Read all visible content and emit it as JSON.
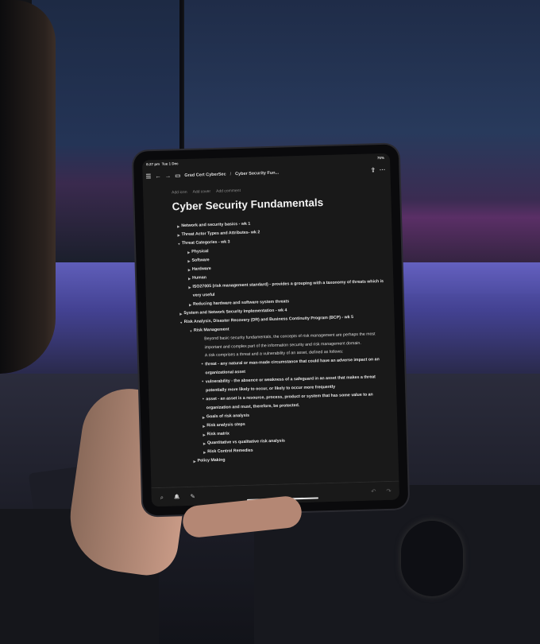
{
  "status": {
    "time": "8:27 pm",
    "date": "Tue 1 Dec",
    "battery": "76%"
  },
  "toolbar": {
    "breadcrumb_parent": "Grad Cert CyberSec",
    "separator": "/",
    "breadcrumb_current": "Cyber Security Fun..."
  },
  "page_meta": {
    "add_icon": "Add icon",
    "add_cover": "Add cover",
    "add_comment": "Add comment"
  },
  "page": {
    "title": "Cyber Security Fundamentals"
  },
  "items": [
    {
      "level": 0,
      "type": "toggle",
      "open": false,
      "text": "Network and security basics - wk 1"
    },
    {
      "level": 0,
      "type": "toggle",
      "open": false,
      "text": "Threat Actor Types and Attributes- wk 2"
    },
    {
      "level": 0,
      "type": "toggle",
      "open": true,
      "text": "Threat Categories - wk 3"
    },
    {
      "level": 1,
      "type": "toggle",
      "open": false,
      "text": "Physical"
    },
    {
      "level": 1,
      "type": "toggle",
      "open": false,
      "text": "Software"
    },
    {
      "level": 1,
      "type": "toggle",
      "open": false,
      "text": "Hardware"
    },
    {
      "level": 1,
      "type": "toggle",
      "open": false,
      "text": "Human"
    },
    {
      "level": 1,
      "type": "toggle",
      "open": false,
      "text": "ISO27005 (risk management standard) - provides a grouping with a taxonomy of threats which is very useful"
    },
    {
      "level": 1,
      "type": "toggle",
      "open": false,
      "text": "Reducing hardware and software system threats"
    },
    {
      "level": 0,
      "type": "toggle",
      "open": false,
      "text": "System and Network Security Implementation - wk 4"
    },
    {
      "level": 0,
      "type": "toggle",
      "open": true,
      "text": "Risk Analysis, Disaster Recovery (DR) and Business Continuity Program (BCP) - wk 5"
    },
    {
      "level": 1,
      "type": "toggle",
      "open": true,
      "text": "Risk Management"
    },
    {
      "level": 2,
      "type": "para",
      "text": "Beyond basic security fundamentals, the concepts of risk management are perhaps the most important and complex part of the information security and risk management domain."
    },
    {
      "level": 2,
      "type": "para",
      "text": "A risk comprises a threat and a vulnerability of an asset, defined as follows:"
    },
    {
      "level": 2,
      "type": "bullet",
      "text": "threat - any natural or man-made circumstance that could have an adverse impact on an organizational asset"
    },
    {
      "level": 2,
      "type": "bullet",
      "text": "vulnerability - the absence or weakness of a safeguard in an asset that makes a threat potentially more likely to occur, or likely to occur more frequently"
    },
    {
      "level": 2,
      "type": "bullet",
      "text": "asset - an asset is a resource, process, product or system that has some value to an organization and must, therefore, be protected."
    },
    {
      "level": 2,
      "type": "toggle",
      "open": false,
      "text": "Goals of risk analysis"
    },
    {
      "level": 2,
      "type": "toggle",
      "open": false,
      "text": "Risk analysis steps"
    },
    {
      "level": 2,
      "type": "toggle",
      "open": false,
      "text": "Risk matrix"
    },
    {
      "level": 2,
      "type": "toggle",
      "open": false,
      "text": "Quantitative vs qualitative risk analysis"
    },
    {
      "level": 2,
      "type": "toggle",
      "open": false,
      "text": "Risk Control Remedies"
    },
    {
      "level": 1,
      "type": "toggle",
      "open": false,
      "text": "Policy Making"
    }
  ],
  "icons": {
    "menu": "☰",
    "back": "←",
    "forward": "→",
    "page": "▭",
    "share": "⇪",
    "more": "···",
    "search": "⌕",
    "bell": "🔔",
    "compose": "✎",
    "undo": "↶",
    "redo": "↷"
  }
}
